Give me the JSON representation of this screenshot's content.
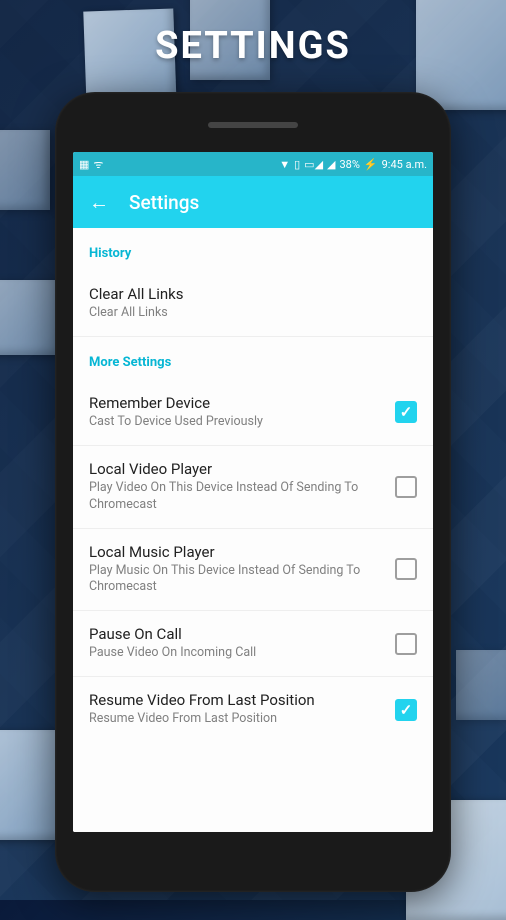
{
  "pageTitle": "SETTINGS",
  "statusBar": {
    "battery": "38%",
    "time": "9:45 a.m."
  },
  "appBar": {
    "title": "Settings"
  },
  "sections": {
    "history": {
      "header": "History",
      "clearLinks": {
        "title": "Clear All Links",
        "subtitle": "Clear All Links"
      }
    },
    "more": {
      "header": "More Settings",
      "rememberDevice": {
        "title": "Remember Device",
        "subtitle": "Cast To Device Used Previously",
        "checked": true
      },
      "localVideo": {
        "title": "Local Video Player",
        "subtitle": "Play Video On This Device Instead Of Sending To Chromecast",
        "checked": false
      },
      "localMusic": {
        "title": "Local Music Player",
        "subtitle": "Play Music On This Device Instead Of Sending To Chromecast",
        "checked": false
      },
      "pauseOnCall": {
        "title": "Pause On Call",
        "subtitle": "Pause Video On Incoming Call",
        "checked": false
      },
      "resumeVideo": {
        "title": "Resume Video From Last Position",
        "subtitle": "Resume Video From Last Position",
        "checked": true
      }
    }
  }
}
